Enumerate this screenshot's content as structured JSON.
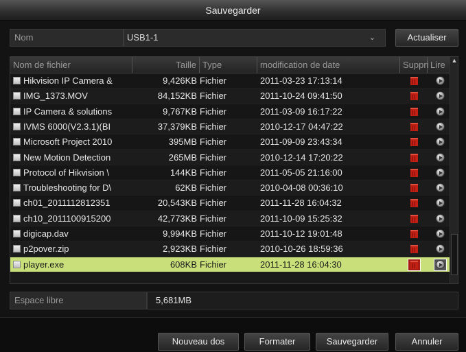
{
  "dialog": {
    "title": "Sauvegarder"
  },
  "device": {
    "label": "Nom",
    "selected": "USB1-1",
    "refresh_label": "Actualiser"
  },
  "table": {
    "columns": {
      "name": "Nom de fichier",
      "size": "Taille",
      "type": "Type",
      "date": "modification de date",
      "delete": "Suppri",
      "play": "Lire"
    },
    "rows": [
      {
        "name": "Hikvision IP Camera &",
        "size": "9,426KB",
        "type": "Fichier",
        "date": "2011-03-23 17:13:14"
      },
      {
        "name": "IMG_1373.MOV",
        "size": "84,152KB",
        "type": "Fichier",
        "date": "2011-10-24 09:41:50"
      },
      {
        "name": "IP Camera & solutions",
        "size": "9,767KB",
        "type": "Fichier",
        "date": "2011-03-09 16:17:22"
      },
      {
        "name": "IVMS 6000(V2.3.1)(BI",
        "size": "37,379KB",
        "type": "Fichier",
        "date": "2010-12-17 04:47:22"
      },
      {
        "name": "Microsoft Project 2010",
        "size": "395MB",
        "type": "Fichier",
        "date": "2011-09-09 23:43:34"
      },
      {
        "name": "New Motion Detection",
        "size": "265MB",
        "type": "Fichier",
        "date": "2010-12-14 17:20:22"
      },
      {
        "name": "Protocol of Hikvision \\",
        "size": "144KB",
        "type": "Fichier",
        "date": "2011-05-05 21:16:00"
      },
      {
        "name": "Troubleshooting for D\\",
        "size": "62KB",
        "type": "Fichier",
        "date": "2010-04-08 00:36:10"
      },
      {
        "name": "ch01_2011112812351",
        "size": "20,543KB",
        "type": "Fichier",
        "date": "2011-11-28 16:04:32"
      },
      {
        "name": "ch10_2011100915200",
        "size": "42,773KB",
        "type": "Fichier",
        "date": "2011-10-09 15:25:32"
      },
      {
        "name": "digicap.dav",
        "size": "9,994KB",
        "type": "Fichier",
        "date": "2011-10-12 19:01:48"
      },
      {
        "name": "p2pover.zip",
        "size": "2,923KB",
        "type": "Fichier",
        "date": "2010-10-26 18:59:36"
      },
      {
        "name": "player.exe",
        "size": "608KB",
        "type": "Fichier",
        "date": "2011-11-28 16:04:30",
        "selected": true
      }
    ]
  },
  "free_space": {
    "label": "Espace libre",
    "value": "5,681MB"
  },
  "buttons": {
    "new_folder": "Nouveau dos",
    "format": "Formater",
    "save": "Sauvegarder",
    "cancel": "Annuler"
  },
  "colors": {
    "selected_row": "#c9e07a",
    "delete_icon": "#c01f14"
  }
}
